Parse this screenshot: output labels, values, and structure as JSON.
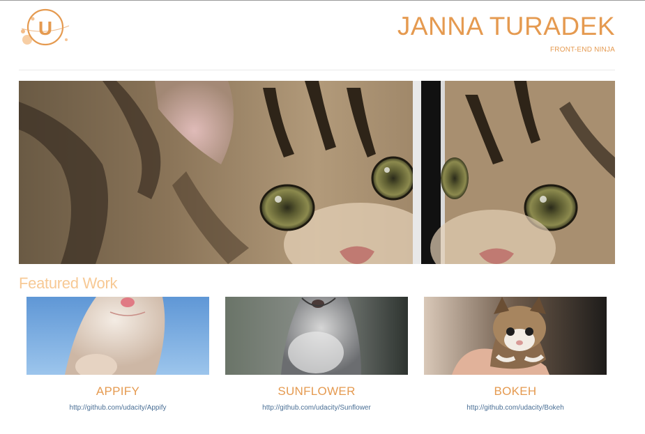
{
  "header": {
    "logo_letter": "U",
    "name": "JANNA TURADEK",
    "subtitle": "FRONT-END NINJA"
  },
  "hero": {
    "image_alt": "kitten-banner"
  },
  "featured": {
    "title": "Featured Work",
    "projects": [
      {
        "title": "APPIFY",
        "link": "http://github.com/udacity/Appify"
      },
      {
        "title": "SUNFLOWER",
        "link": "http://github.com/udacity/Sunflower"
      },
      {
        "title": "BOKEH",
        "link": "http://github.com/udacity/Bokeh"
      }
    ]
  },
  "colors": {
    "accent": "#e59a50",
    "featured_heading": "#f7c995",
    "link": "#4a6f95"
  }
}
